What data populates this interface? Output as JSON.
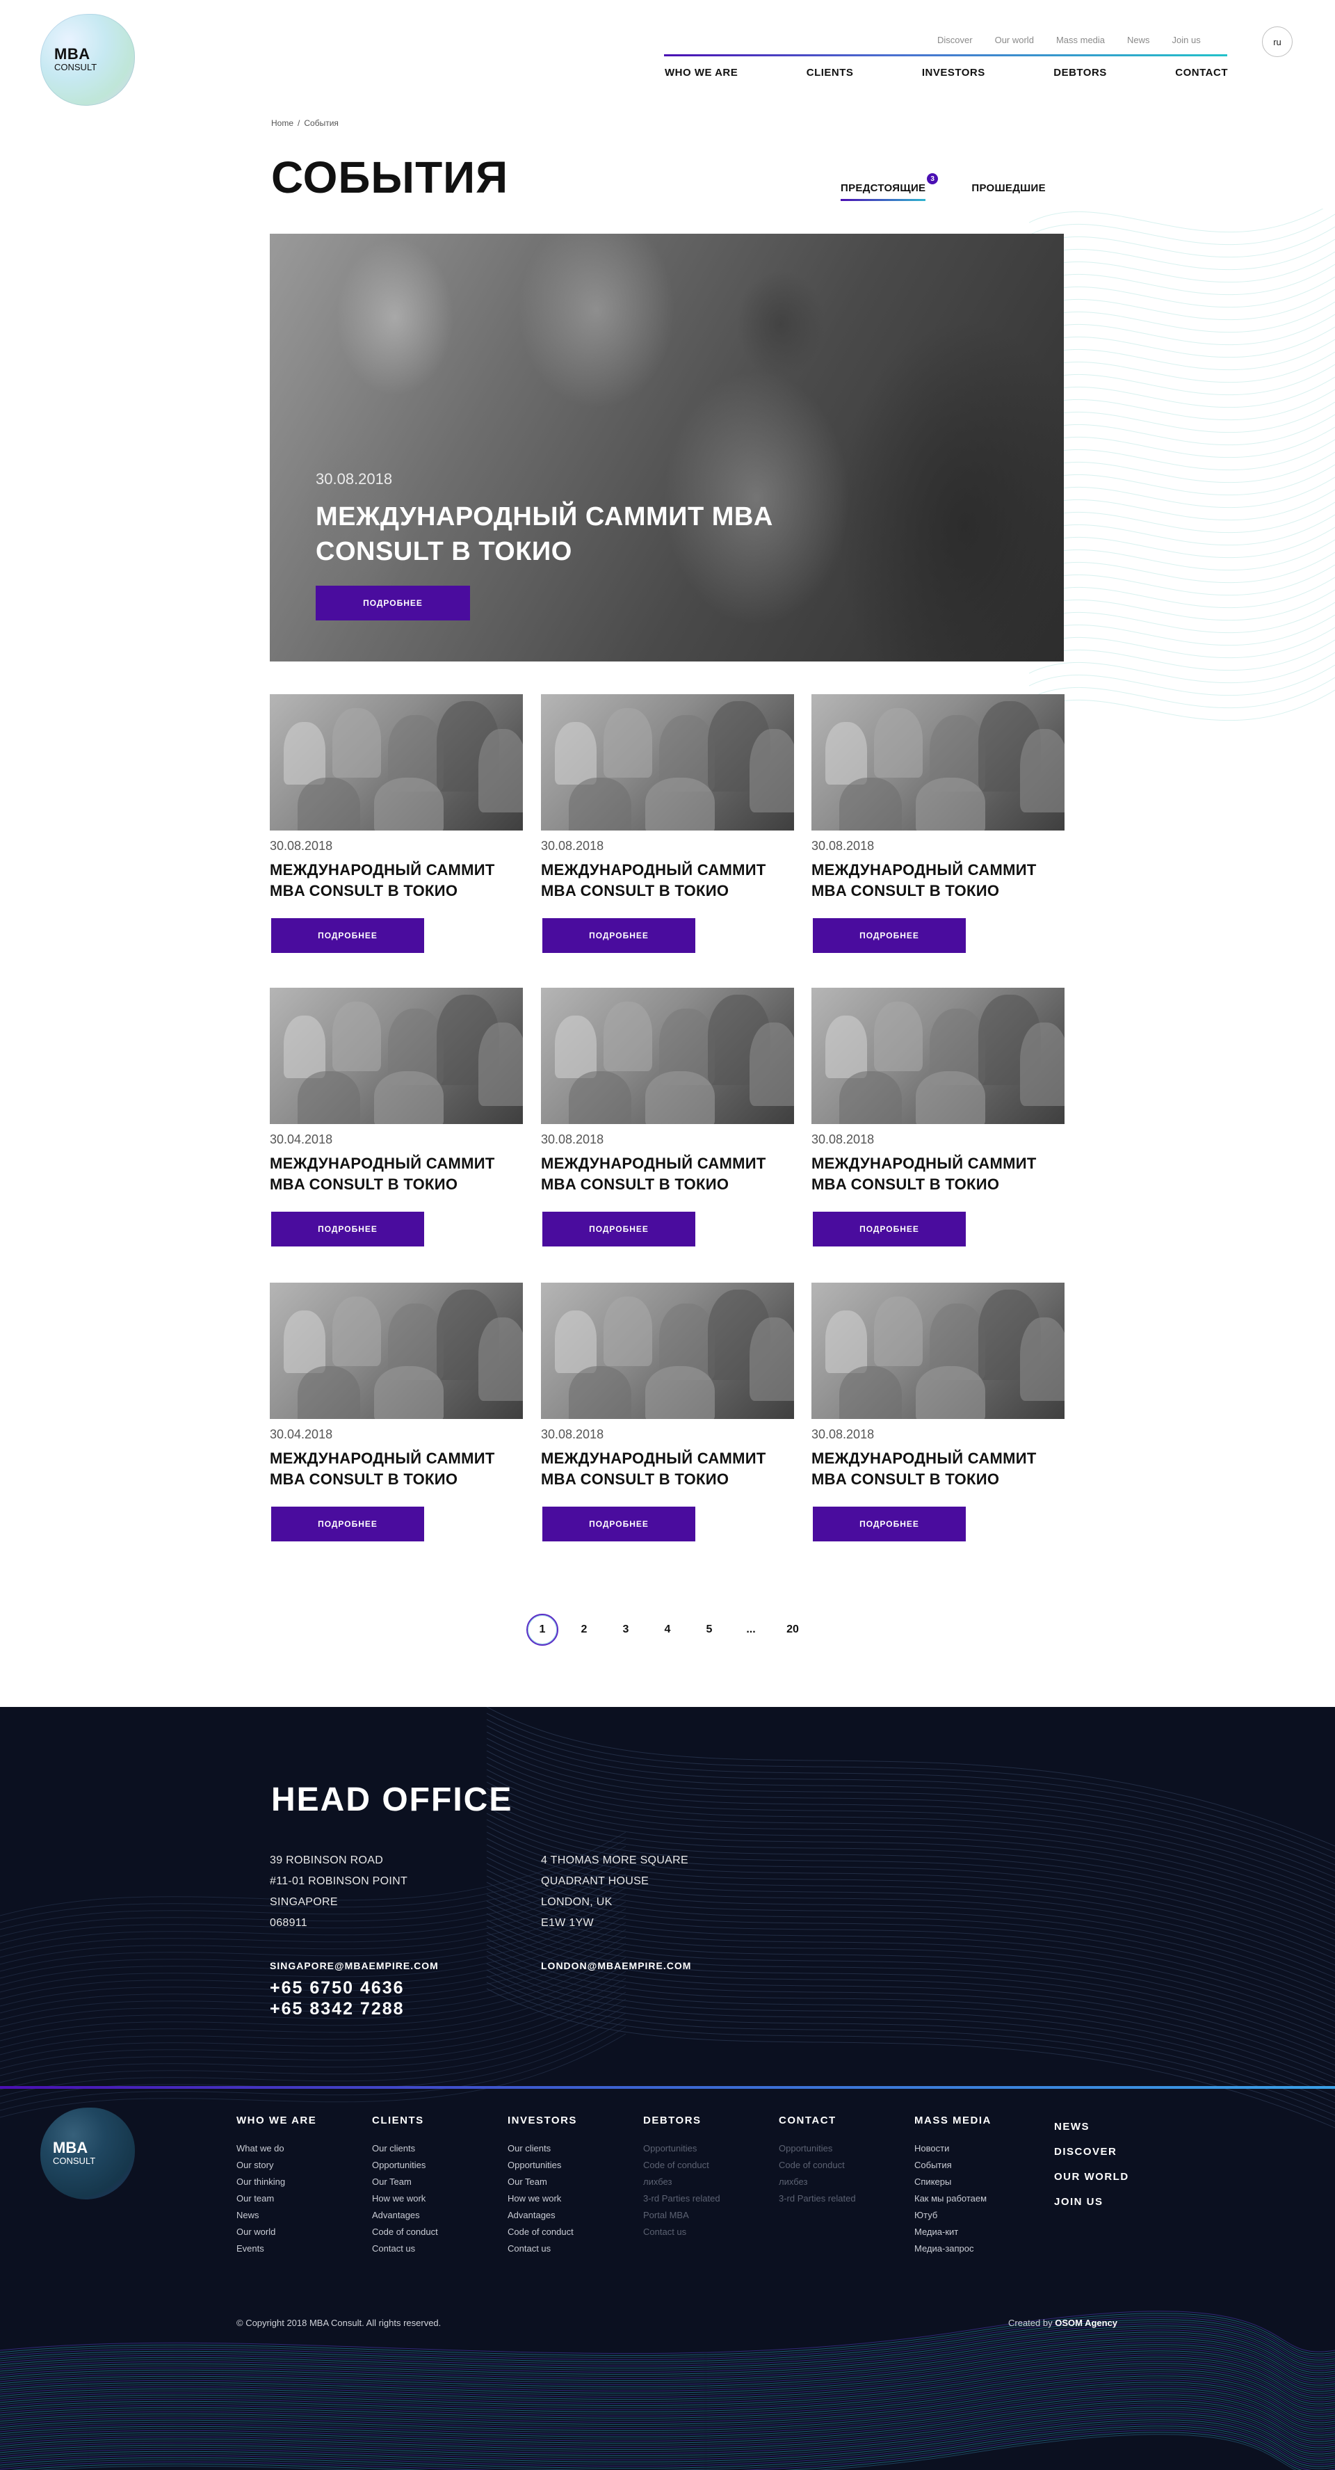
{
  "logo": {
    "line1": "MBA",
    "line2": "CONSULT"
  },
  "top_nav": [
    "Discover",
    "Our world",
    "Mass media",
    "News",
    "Join us"
  ],
  "main_nav": [
    "WHO WE ARE",
    "CLIENTS",
    "INVESTORS",
    "DEBTORS",
    "CONTACT"
  ],
  "lang": "ru",
  "breadcrumb": {
    "home": "Home",
    "separator": "/",
    "current": "События"
  },
  "page_title": "СОБЫТИЯ",
  "tabs": {
    "upcoming": "ПРЕДСТОЯЩИЕ",
    "upcoming_badge": "3",
    "past": "ПРОШЕДШИЕ"
  },
  "hero": {
    "date": "30.08.2018",
    "title": "МЕЖДУНАРОДНЫЙ САММИТ MBA CONSULT В ТОКИО",
    "button": "ПОДРОБНЕЕ"
  },
  "cards": [
    {
      "date": "30.08.2018",
      "title": "МЕЖДУНАРОДНЫЙ САММИТ MBA CONSULT В ТОКИО",
      "button": "ПОДРОБНЕЕ"
    },
    {
      "date": "30.08.2018",
      "title": "МЕЖДУНАРОДНЫЙ САММИТ MBA CONSULT В ТОКИО",
      "button": "ПОДРОБНЕЕ"
    },
    {
      "date": "30.08.2018",
      "title": "МЕЖДУНАРОДНЫЙ САММИТ MBA CONSULT В ТОКИО",
      "button": "ПОДРОБНЕЕ"
    },
    {
      "date": "30.04.2018",
      "title": "МЕЖДУНАРОДНЫЙ САММИТ MBA CONSULT В ТОКИО",
      "button": "ПОДРОБНЕЕ"
    },
    {
      "date": "30.08.2018",
      "title": "МЕЖДУНАРОДНЫЙ САММИТ MBA CONSULT В ТОКИО",
      "button": "ПОДРОБНЕЕ"
    },
    {
      "date": "30.08.2018",
      "title": "МЕЖДУНАРОДНЫЙ САММИТ MBA CONSULT В ТОКИО",
      "button": "ПОДРОБНЕЕ"
    },
    {
      "date": "30.04.2018",
      "title": "МЕЖДУНАРОДНЫЙ САММИТ MBA CONSULT В ТОКИО",
      "button": "ПОДРОБНЕЕ"
    },
    {
      "date": "30.08.2018",
      "title": "МЕЖДУНАРОДНЫЙ САММИТ MBA CONSULT В ТОКИО",
      "button": "ПОДРОБНЕЕ"
    },
    {
      "date": "30.08.2018",
      "title": "МЕЖДУНАРОДНЫЙ САММИТ MBA CONSULT В ТОКИО",
      "button": "ПОДРОБНЕЕ"
    }
  ],
  "pagination": {
    "current": "1",
    "pages": [
      "1",
      "2",
      "3",
      "4",
      "5",
      "...",
      "20"
    ]
  },
  "head_office": {
    "title": "HEAD OFFICE",
    "singapore": {
      "lines": [
        "39 ROBINSON ROAD",
        "#11-01 ROBINSON POINT",
        "SINGAPORE",
        "068911"
      ],
      "email": "SINGAPORE@MBAEMPIRE.COM",
      "phones": [
        "+65 6750 4636",
        "+65 8342 7288"
      ]
    },
    "london": {
      "lines": [
        "4 THOMAS MORE SQUARE",
        "QUADRANT HOUSE",
        "LONDON, UK",
        "E1W 1YW"
      ],
      "email": "LONDON@MBAEMPIRE.COM"
    }
  },
  "footer_columns": [
    {
      "heading": "WHO WE ARE",
      "items": [
        "What we do",
        "Our story",
        "Our thinking",
        "Our team",
        "News",
        "Our world",
        "Events"
      ]
    },
    {
      "heading": "CLIENTS",
      "items": [
        "Our clients",
        "Opportunities",
        "Our Team",
        "How we work",
        "Advantages",
        "Code of conduct",
        "Contact us"
      ]
    },
    {
      "heading": "INVESTORS",
      "items": [
        "Our clients",
        "Opportunities",
        "Our Team",
        "How we work",
        "Advantages",
        "Code of conduct",
        "Contact us"
      ]
    },
    {
      "heading": "DEBTORS",
      "items": [
        "Opportunities",
        "Code of conduct",
        "лихбез",
        "3-rd Parties related",
        "Portal MBA",
        "Contact us"
      ]
    },
    {
      "heading": "CONTACT",
      "items": [
        "Opportunities",
        "Code of conduct",
        "лихбез",
        "3-rd Parties related"
      ]
    },
    {
      "heading": "MASS MEDIA",
      "items": [
        "Новости",
        "События",
        "Спикеры",
        "Как мы работаем",
        "Ютуб",
        "Медиа-кит",
        "Медиа-запрос"
      ]
    }
  ],
  "footer_links": [
    "NEWS",
    "DISCOVER",
    "OUR WORLD",
    "JOIN US"
  ],
  "copyright": "© Copyright 2018 MBA Consult. All rights reserved.",
  "created": {
    "prefix": "Created by",
    "agency": "OSOM Agency"
  },
  "colors": {
    "accent": "#4a0c9e",
    "footer_bg": "#0b1020",
    "gradient_end": "#22c1c9"
  }
}
